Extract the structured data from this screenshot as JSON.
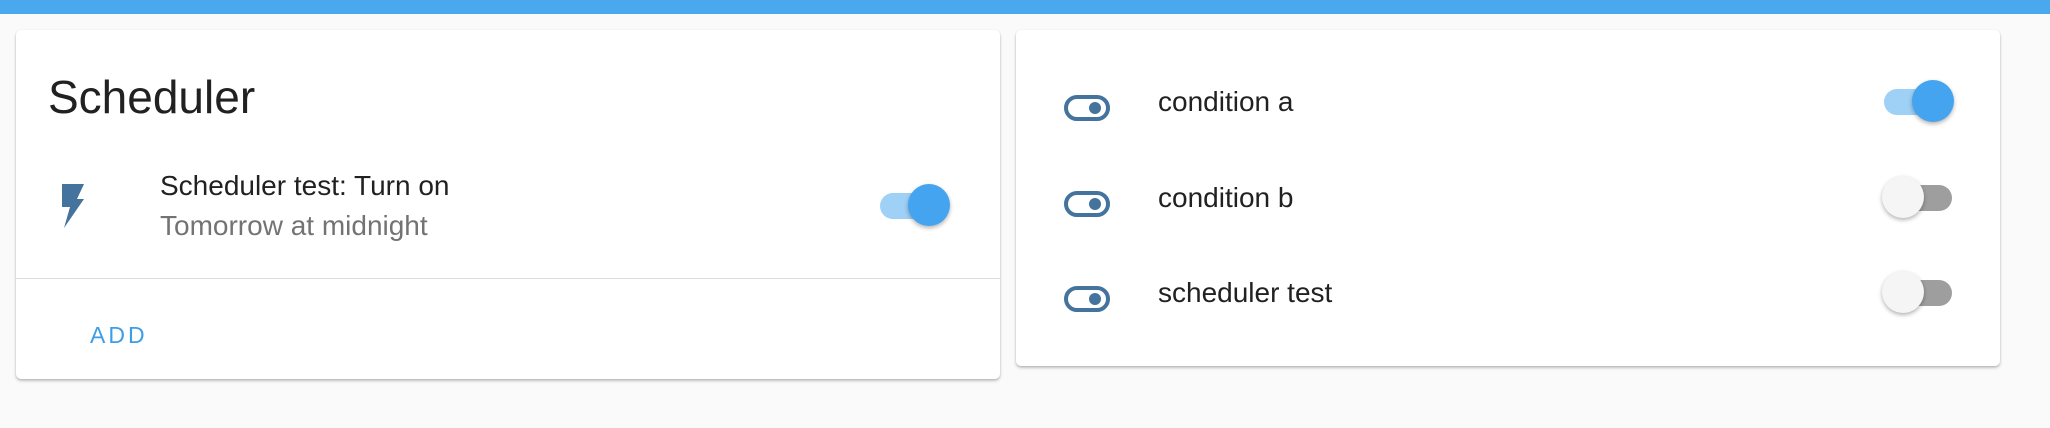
{
  "scheduler_card": {
    "title": "Scheduler",
    "entry": {
      "icon": "flash-icon",
      "name": "Scheduler test: Turn on",
      "time": "Tomorrow at midnight",
      "enabled": true
    },
    "add_label": "ADD"
  },
  "entities_card": {
    "rows": [
      {
        "icon": "toggle-switch-icon",
        "label": "condition a",
        "state": true
      },
      {
        "icon": "toggle-switch-icon",
        "label": "condition b",
        "state": false
      },
      {
        "icon": "toggle-switch-icon",
        "label": "scheduler test",
        "state": false
      }
    ]
  },
  "colors": {
    "header_bar": "#4aa8ee",
    "accent": "#44a4f0",
    "accent_track": "#9fd0f6",
    "icon": "#44739e",
    "off_track": "#9e9e9e",
    "secondary_text": "#737373"
  }
}
